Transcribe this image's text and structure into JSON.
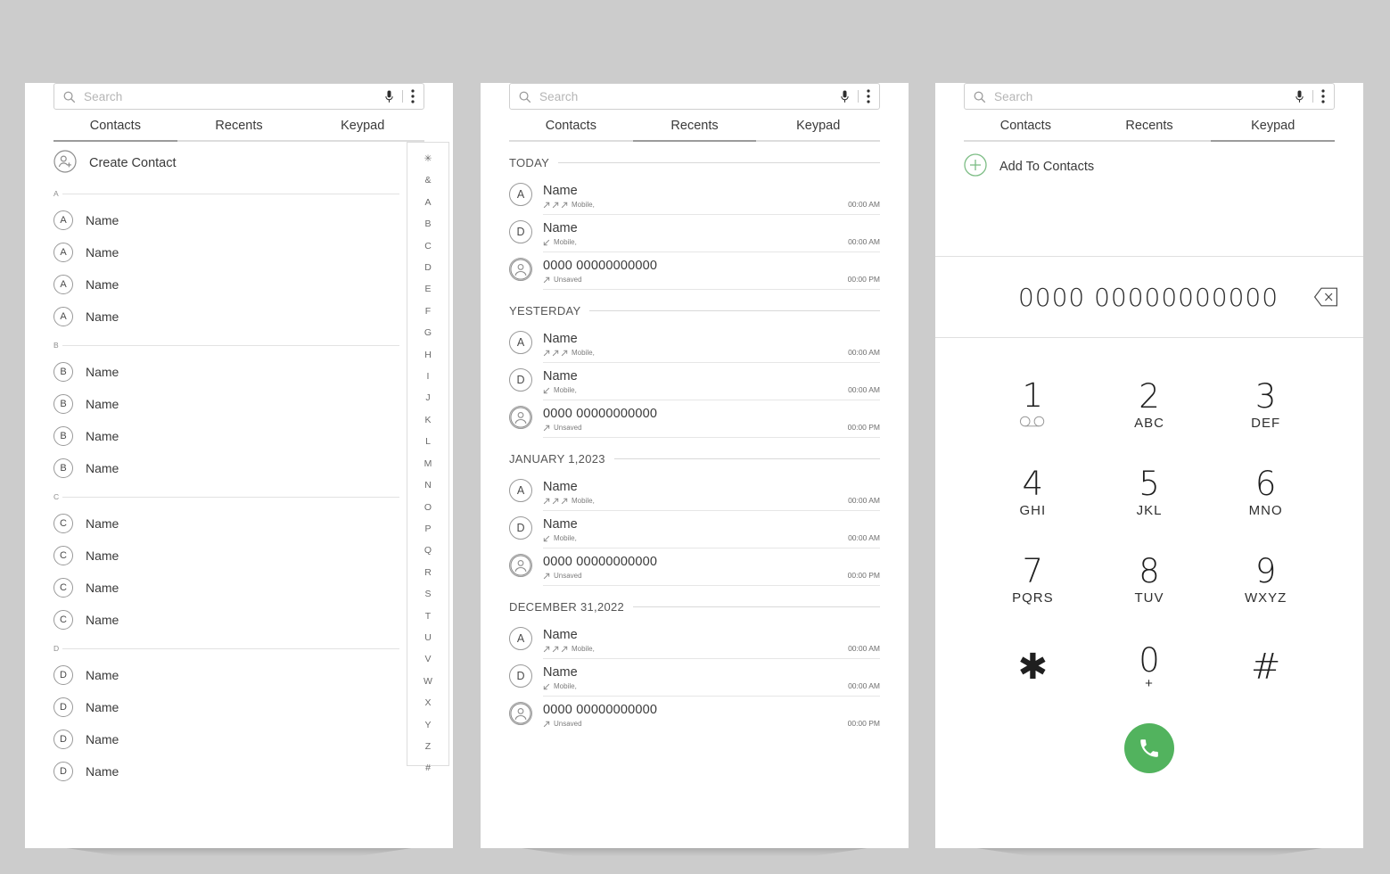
{
  "theme": {
    "page_background": "#cccccc",
    "card_background": "#ffffff",
    "accent_green": "#52b35e",
    "add_icon_green": "#7dbd85",
    "text_primary": "#3a3a3a",
    "text_muted": "#7c7c7c",
    "divider": "#e2e2e2",
    "tab_active_underline": "#9b9b9b"
  },
  "search": {
    "placeholder": "Search",
    "icons": [
      "search-icon",
      "mic-icon",
      "more-vert-icon"
    ]
  },
  "tabs": [
    {
      "label": "Contacts"
    },
    {
      "label": "Recents"
    },
    {
      "label": "Keypad"
    }
  ],
  "panels": {
    "contacts": {
      "active_tab_index": 0,
      "create_contact": {
        "label": "Create Contact",
        "icon": "person-add-icon"
      },
      "sections": [
        {
          "letter": "A",
          "contacts": [
            {
              "avatar": "A",
              "name": "Name"
            },
            {
              "avatar": "A",
              "name": "Name"
            },
            {
              "avatar": "A",
              "name": "Name"
            },
            {
              "avatar": "A",
              "name": "Name"
            }
          ]
        },
        {
          "letter": "B",
          "contacts": [
            {
              "avatar": "B",
              "name": "Name"
            },
            {
              "avatar": "B",
              "name": "Name"
            },
            {
              "avatar": "B",
              "name": "Name"
            },
            {
              "avatar": "B",
              "name": "Name"
            }
          ]
        },
        {
          "letter": "C",
          "contacts": [
            {
              "avatar": "C",
              "name": "Name"
            },
            {
              "avatar": "C",
              "name": "Name"
            },
            {
              "avatar": "C",
              "name": "Name"
            },
            {
              "avatar": "C",
              "name": "Name"
            }
          ]
        },
        {
          "letter": "D",
          "contacts": [
            {
              "avatar": "D",
              "name": "Name"
            },
            {
              "avatar": "D",
              "name": "Name"
            },
            {
              "avatar": "D",
              "name": "Name"
            },
            {
              "avatar": "D",
              "name": "Name"
            }
          ]
        }
      ],
      "alpha_index": [
        "✳",
        "&",
        "A",
        "B",
        "C",
        "D",
        "E",
        "F",
        "G",
        "H",
        "I",
        "J",
        "K",
        "L",
        "M",
        "N",
        "O",
        "P",
        "Q",
        "R",
        "S",
        "T",
        "U",
        "V",
        "W",
        "X",
        "Y",
        "Z",
        "#"
      ]
    },
    "recents": {
      "active_tab_index": 1,
      "groups": [
        {
          "date_label": "TODAY",
          "calls": [
            {
              "avatar": "A",
              "avatar_type": "letter",
              "title": "Name",
              "direction": "outgoing",
              "arrow_count": 3,
              "meta": "Mobile,",
              "time": "00:00 AM"
            },
            {
              "avatar": "D",
              "avatar_type": "letter",
              "title": "Name",
              "direction": "incoming",
              "arrow_count": 1,
              "meta": "Mobile,",
              "time": "00:00 AM"
            },
            {
              "avatar": "person-icon",
              "avatar_type": "person",
              "title": "0000 00000000000",
              "direction": "outgoing",
              "arrow_count": 1,
              "meta": "Unsaved",
              "time": "00:00 PM"
            }
          ]
        },
        {
          "date_label": "YESTERDAY",
          "calls": [
            {
              "avatar": "A",
              "avatar_type": "letter",
              "title": "Name",
              "direction": "outgoing",
              "arrow_count": 3,
              "meta": "Mobile,",
              "time": "00:00 AM"
            },
            {
              "avatar": "D",
              "avatar_type": "letter",
              "title": "Name",
              "direction": "incoming",
              "arrow_count": 1,
              "meta": "Mobile,",
              "time": "00:00 AM"
            },
            {
              "avatar": "person-icon",
              "avatar_type": "person",
              "title": "0000 00000000000",
              "direction": "outgoing",
              "arrow_count": 1,
              "meta": "Unsaved",
              "time": "00:00 PM"
            }
          ]
        },
        {
          "date_label": "JANUARY 1,2023",
          "calls": [
            {
              "avatar": "A",
              "avatar_type": "letter",
              "title": "Name",
              "direction": "outgoing",
              "arrow_count": 3,
              "meta": "Mobile,",
              "time": "00:00 AM"
            },
            {
              "avatar": "D",
              "avatar_type": "letter",
              "title": "Name",
              "direction": "incoming",
              "arrow_count": 1,
              "meta": "Mobile,",
              "time": "00:00 AM"
            },
            {
              "avatar": "person-icon",
              "avatar_type": "person",
              "title": "0000 00000000000",
              "direction": "outgoing",
              "arrow_count": 1,
              "meta": "Unsaved",
              "time": "00:00 PM"
            }
          ]
        },
        {
          "date_label": "DECEMBER 31,2022",
          "calls": [
            {
              "avatar": "A",
              "avatar_type": "letter",
              "title": "Name",
              "direction": "outgoing",
              "arrow_count": 3,
              "meta": "Mobile,",
              "time": "00:00 AM"
            },
            {
              "avatar": "D",
              "avatar_type": "letter",
              "title": "Name",
              "direction": "incoming",
              "arrow_count": 1,
              "meta": "Mobile,",
              "time": "00:00 AM"
            },
            {
              "avatar": "person-icon",
              "avatar_type": "person",
              "title": "0000 00000000000",
              "direction": "outgoing",
              "arrow_count": 1,
              "meta": "Unsaved",
              "time": "00:00 PM"
            }
          ]
        }
      ]
    },
    "keypad": {
      "active_tab_index": 2,
      "add_to_contacts": {
        "label": "Add To Contacts",
        "icon": "plus-circle-icon"
      },
      "dialed_number": "0000 00000000000",
      "backspace_icon": "backspace-icon",
      "keys": [
        {
          "digit": "1",
          "sub": "",
          "icon": "voicemail-icon"
        },
        {
          "digit": "2",
          "sub": "ABC",
          "icon": ""
        },
        {
          "digit": "3",
          "sub": "DEF",
          "icon": ""
        },
        {
          "digit": "4",
          "sub": "GHI",
          "icon": ""
        },
        {
          "digit": "5",
          "sub": "JKL",
          "icon": ""
        },
        {
          "digit": "6",
          "sub": "MNO",
          "icon": ""
        },
        {
          "digit": "7",
          "sub": "PQRS",
          "icon": ""
        },
        {
          "digit": "8",
          "sub": "TUV",
          "icon": ""
        },
        {
          "digit": "9",
          "sub": "WXYZ",
          "icon": ""
        },
        {
          "digit": "✱",
          "sub": "",
          "icon": ""
        },
        {
          "digit": "0",
          "sub": "+",
          "icon": ""
        },
        {
          "digit": "#",
          "sub": "",
          "icon": ""
        }
      ],
      "call_button": {
        "icon": "phone-icon",
        "color": "#52b35e"
      }
    }
  }
}
